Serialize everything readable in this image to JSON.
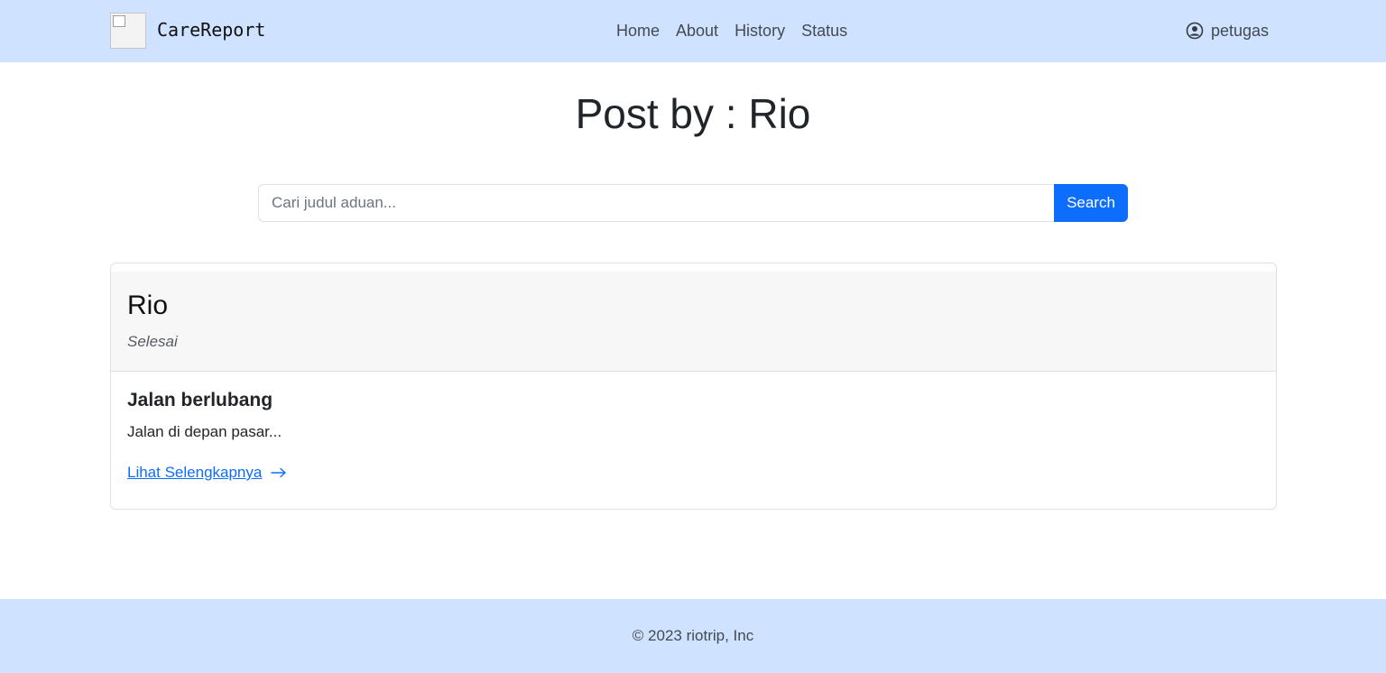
{
  "navbar": {
    "brand": "CareReport",
    "links": [
      "Home",
      "About",
      "History",
      "Status"
    ],
    "user": "petugas",
    "icons": {
      "brand_logo": "broken-image-icon",
      "user": "person-circle-icon"
    }
  },
  "page": {
    "title": "Post by : Rio"
  },
  "search": {
    "placeholder": "Cari judul aduan...",
    "button_label": "Search"
  },
  "post": {
    "author": "Rio",
    "status": "Selesai",
    "title": "Jalan berlubang",
    "excerpt": "Jalan di depan pasar...",
    "link_label": "Lihat Selengkapnya",
    "link_icon": "arrow-right-icon"
  },
  "footer": {
    "text": "© 2023 riotrip, Inc"
  },
  "colors": {
    "navbar_bg": "#cfe2ff",
    "primary": "#0d6efd",
    "card_header_bg": "#f7f7f7"
  }
}
